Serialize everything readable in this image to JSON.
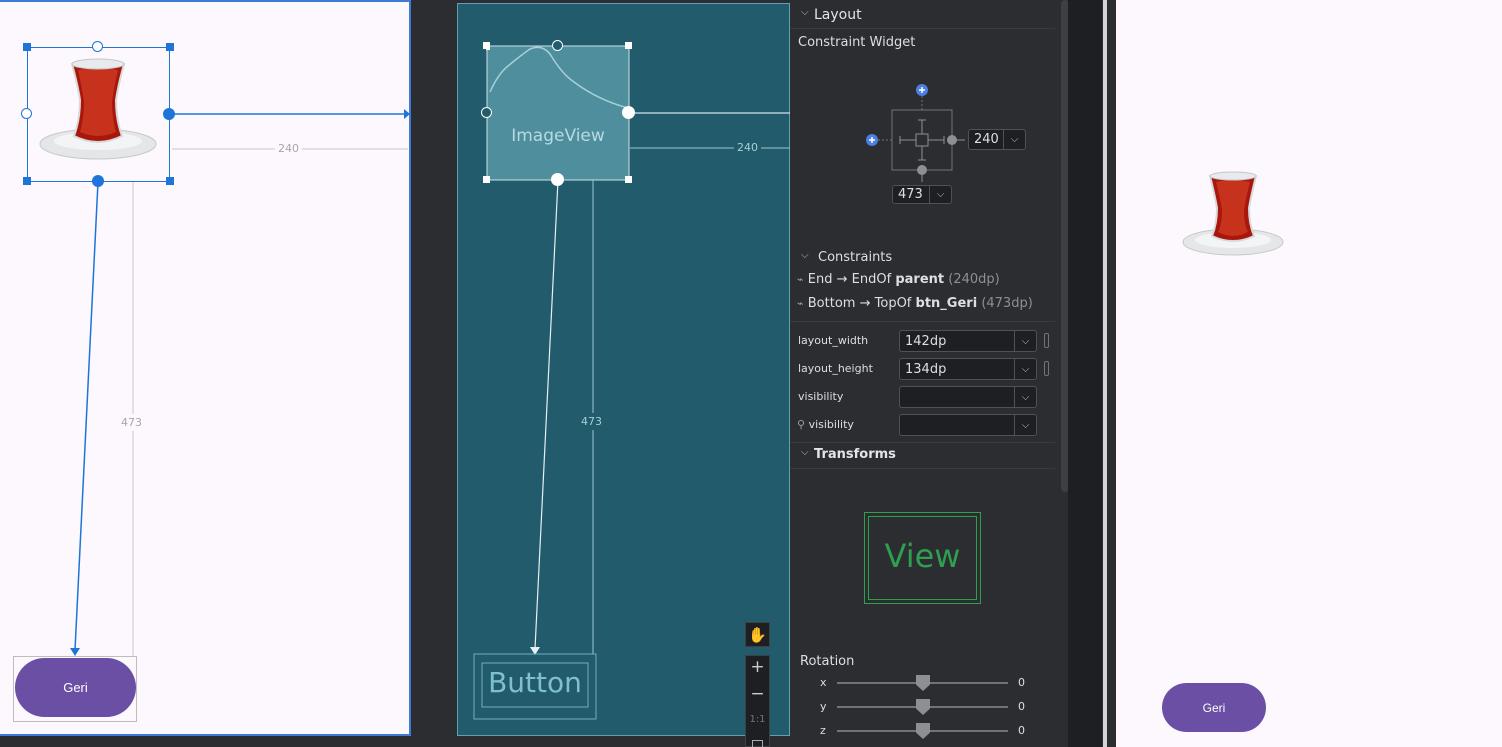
{
  "design": {
    "image_alt": "Tea glass",
    "dim_end": "240",
    "dim_bottom": "473",
    "button_label": "Geri"
  },
  "blueprint": {
    "image_label": "ImageView",
    "dim_end": "240",
    "dim_bottom": "473",
    "button_label": "Button"
  },
  "canvas_toolbar": {
    "pan_icon": "hand-icon",
    "zoom_in": "+",
    "zoom_out": "−",
    "actual_size": "1:1"
  },
  "attributes": {
    "layout_section": "Layout",
    "widget_title": "Constraint Widget",
    "margin_end": "240",
    "margin_bottom": "473",
    "constraints_section": "Constraints",
    "constraints": [
      {
        "side": "End",
        "arrow": "→",
        "target_prefix": "EndOf",
        "target": "parent",
        "value": "(240dp)"
      },
      {
        "side": "Bottom",
        "arrow": "→",
        "target_prefix": "TopOf",
        "target": "btn_Geri",
        "value": "(473dp)"
      }
    ],
    "props": [
      {
        "label": "layout_width",
        "value": "142dp"
      },
      {
        "label": "layout_height",
        "value": "134dp"
      },
      {
        "label": "visibility",
        "value": ""
      },
      {
        "label": "visibility",
        "value": ""
      }
    ],
    "transforms_section": "Transforms",
    "transform_preview": "View",
    "rotation_title": "Rotation",
    "rotation": [
      {
        "axis": "x",
        "value": "0"
      },
      {
        "axis": "y",
        "value": "0"
      },
      {
        "axis": "z",
        "value": "0"
      }
    ]
  },
  "preview": {
    "button_label": "Geri"
  },
  "colors": {
    "accent": "#1e74d8",
    "blueprint": "#225b6b",
    "button": "#6a4fa5",
    "transform_green": "#2e9e4f"
  }
}
